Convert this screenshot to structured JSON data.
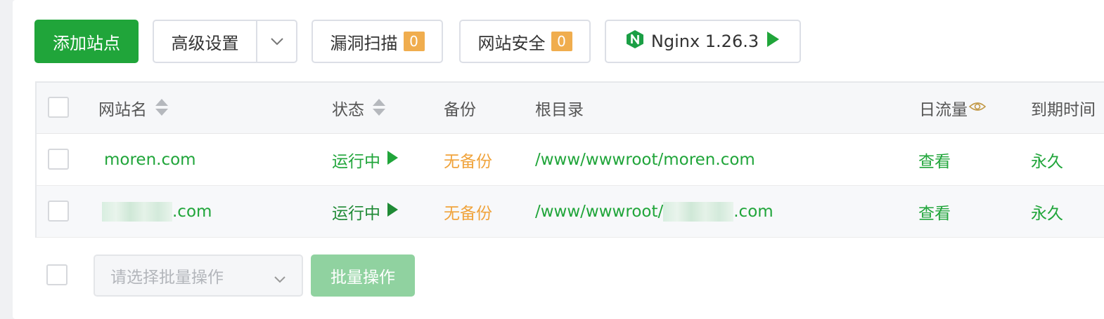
{
  "toolbar": {
    "add_site": "添加站点",
    "advanced": "高级设置",
    "vuln_scan": {
      "label": "漏洞扫描",
      "count": "0"
    },
    "site_security": {
      "label": "网站安全",
      "count": "0"
    },
    "nginx": {
      "label": "Nginx 1.26.3"
    }
  },
  "table": {
    "headers": {
      "name": "网站名",
      "status": "状态",
      "backup": "备份",
      "root": "根目录",
      "traffic": "日流量",
      "expire": "到期时间"
    },
    "rows": [
      {
        "name": "moren.com",
        "status": "运行中",
        "backup": "无备份",
        "root": "/www/wwwroot/moren.com",
        "traffic": "查看",
        "expire": "永久"
      },
      {
        "name": ".com",
        "status": "运行中",
        "backup": "无备份",
        "root_prefix": "/www/wwwroot/",
        "root_suffix": ".com",
        "traffic": "查看",
        "expire": "永久"
      }
    ]
  },
  "footer": {
    "batch_placeholder": "请选择批量操作",
    "batch_button": "批量操作"
  },
  "colors": {
    "primary": "#20a53a",
    "warning": "#f0ad4e",
    "backup_text": "#f0a33b"
  }
}
